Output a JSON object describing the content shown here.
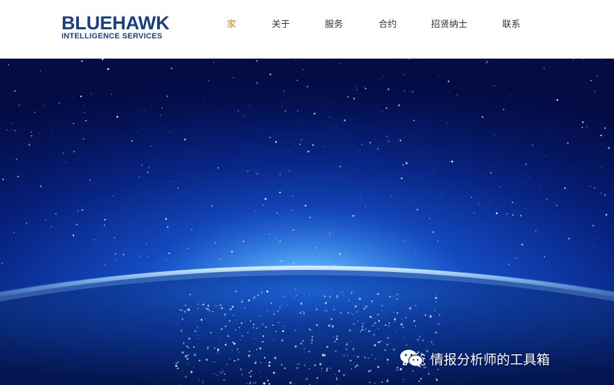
{
  "logo": {
    "brand": "BLUEHAWK",
    "tagline": "INTELLIGENCE SERVICES"
  },
  "nav": {
    "items": [
      {
        "label": "家",
        "active": true
      },
      {
        "label": "关于",
        "active": false
      },
      {
        "label": "服务",
        "active": false
      },
      {
        "label": "合约",
        "active": false
      },
      {
        "label": "招贤纳士",
        "active": false
      },
      {
        "label": "联系",
        "active": false
      }
    ]
  },
  "hero": {
    "image": "earth-from-space-night-lights"
  },
  "watermark": {
    "icon": "wechat-icon",
    "text": "丁爸 情报分析师的工具箱"
  },
  "colors": {
    "brand": "#1a3f7a",
    "nav_active": "#b8862b",
    "nav_default": "#333333"
  }
}
